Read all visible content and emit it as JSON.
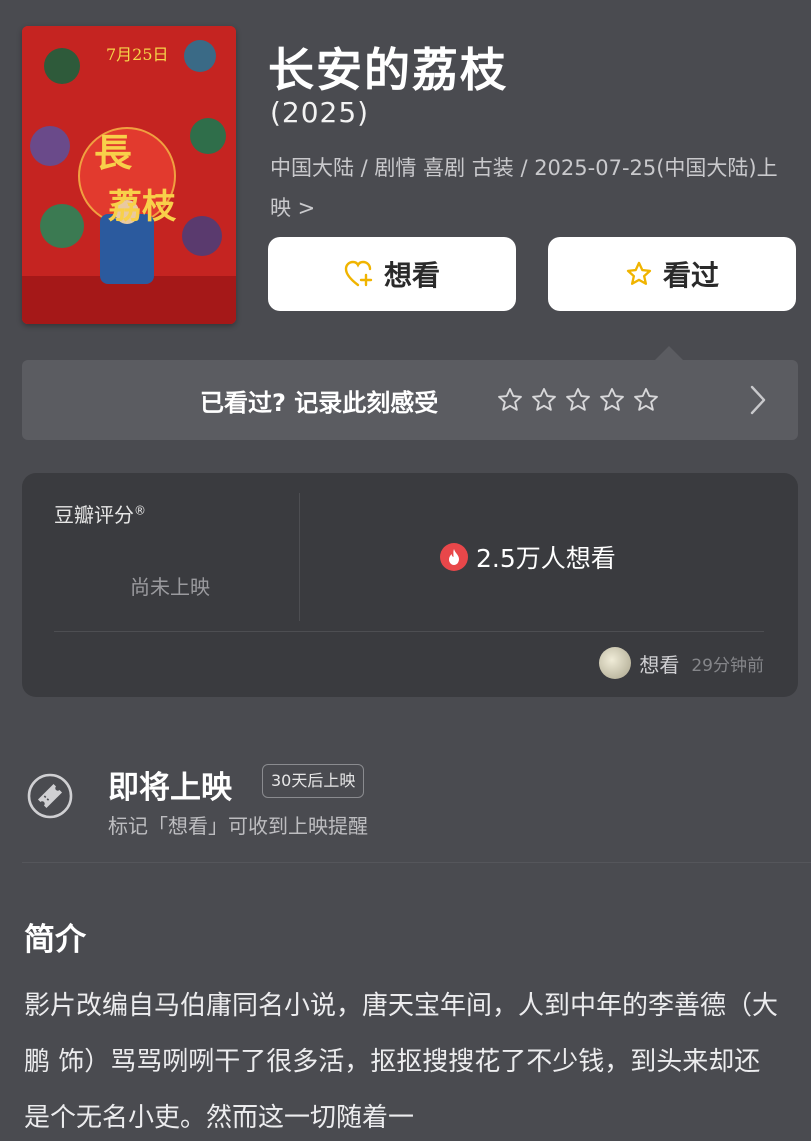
{
  "movie": {
    "title": "长安的荔枝",
    "year": "(2025)",
    "meta": "中国大陆 / 剧情 喜剧 古装 / 2025-07-25(中国大陆)上映 >"
  },
  "actions": {
    "want_label": "想看",
    "seen_label": "看过"
  },
  "rating_prompt": {
    "text": "已看过? 记录此刻感受",
    "stars": 5
  },
  "score": {
    "label": "豆瓣评分",
    "status": "尚未上映",
    "want_count": "2.5万人想看",
    "activity_action": "想看",
    "activity_time": "29分钟前"
  },
  "upcoming": {
    "title": "即将上映",
    "badge": "30天后上映",
    "subtitle": "标记「想看」可收到上映提醒"
  },
  "intro": {
    "heading": "简介",
    "text": "影片改编自马伯庸同名小说，唐天宝年间，人到中年的李善德（大鹏 饰）骂骂咧咧干了很多活，抠抠搜搜花了不少钱，到头来却还是个无名小吏。然而这一切随着一"
  },
  "colors": {
    "background": "#4a4b50",
    "accent_gold": "#f0b400",
    "flame_red": "#e8474a"
  }
}
